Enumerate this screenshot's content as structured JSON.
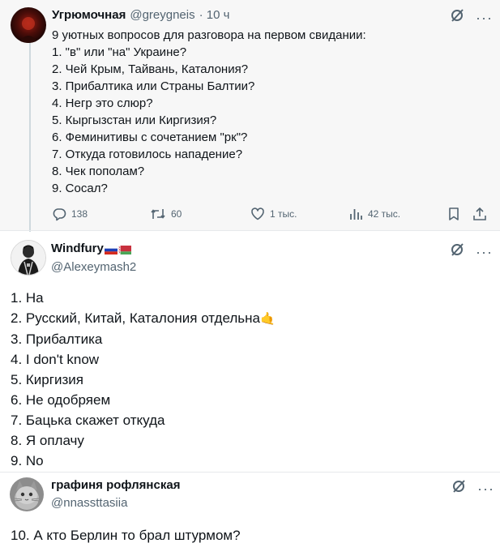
{
  "tweet1": {
    "name": "Угрюмочная",
    "handle": "@greygneis",
    "time": "· 10 ч",
    "lines": [
      "9 уютных вопросов для разговора на первом свидании:",
      "1. \"в\" или \"на\" Украине?",
      "2. Чей Крым, Тайвань, Каталония?",
      "3. Прибалтика или Страны Балтии?",
      "4. Негр это слюр?",
      "5. Кыргызстан или Киргизия?",
      "6. Феминитивы с сочетанием \"рк\"?",
      "7. Откуда готовилось нападение?",
      "8. Чек пополам?",
      "9. Сосал?"
    ],
    "actions": {
      "replies": "138",
      "retweets": "60",
      "likes": "1 тыс.",
      "views": "42 тыс."
    },
    "icons": [
      "no-entry-icon",
      "more-icon",
      "reply-icon",
      "retweet-icon",
      "like-icon",
      "views-icon",
      "bookmark-icon",
      "share-icon"
    ]
  },
  "tweet2": {
    "name": "Windfury",
    "handle": "@Alexeymash2",
    "flags": [
      "russia-flag",
      "belarus-flag"
    ],
    "lines": [
      "1. На",
      "2. Русский, Китай, Каталония отдельна",
      "3. Прибалтика",
      "4. I don't know",
      "5. Киргизия",
      "6. Не одобряем",
      "7. Бацька скажет откуда",
      "8. Я оплачу",
      "9. No"
    ],
    "emoji": "🤙"
  },
  "tweet3": {
    "name": "графиня рофлянская",
    "handle": "@nnassttasiia",
    "text": "10. А кто Берлин то брал штурмом?"
  },
  "colors": {
    "text": "#0f1419",
    "secondary": "#536471",
    "tweet1_bg": "#f7f7f7"
  }
}
